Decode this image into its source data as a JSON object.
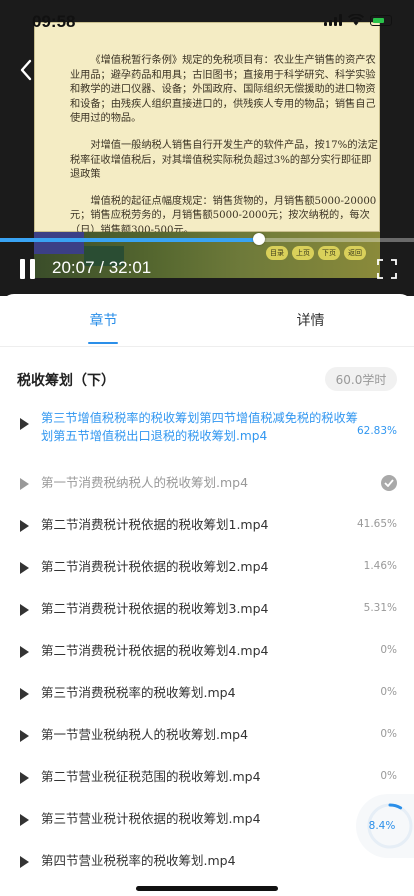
{
  "status_bar": {
    "time": "09:58"
  },
  "player": {
    "slide": {
      "paragraphs": [
        "《增值税暂行条例》规定的免税项目有：农业生产销售的资产农业用品；避孕药品和用具；古旧图书；直接用于科学研究、科学实验和教学的进口仪器、设备；外国政府、国际组织无偿援助的进口物资和设备；由残疾人组织直接进口的，供残疾人专用的物品；销售自己使用过的物品。",
        "对增值一般纳税人销售自行开发生产的软件产品，按17%的法定税率征收增值税后，对其增值税实际税负超过3%的部分实行即征即退政策",
        "增值税的起征点幅度规定：销售货物的，月销售额5000-20000元；销售应税劳务的，月销售额5000-2000元；按次纳税的，每次（日）销售额300-500元。"
      ],
      "tags": [
        "目录",
        "上页",
        "下页",
        "返回"
      ]
    },
    "progress": 0.626,
    "time_readout": "20:07 / 32:01",
    "colors": {
      "accent": "#39a3f3"
    }
  },
  "tabs": [
    {
      "label": "章节",
      "active": true
    },
    {
      "label": "详情",
      "active": false
    }
  ],
  "course": {
    "title": "税收筹划（下）",
    "hours": "60.0学时"
  },
  "lessons": [
    {
      "label": "第三节增值税税率的税收筹划第四节增值税减免税的税收筹划第五节增值税出口退税的税收筹划.mp4",
      "progress": "62.83%",
      "state": "active"
    },
    {
      "label": "第一节消费税纳税人的税收筹划.mp4",
      "progress": "",
      "state": "done"
    },
    {
      "label": "第二节消费税计税依据的税收筹划1.mp4",
      "progress": "41.65%",
      "state": "normal"
    },
    {
      "label": "第二节消费税计税依据的税收筹划2.mp4",
      "progress": "1.46%",
      "state": "normal"
    },
    {
      "label": "第二节消费税计税依据的税收筹划3.mp4",
      "progress": "5.31%",
      "state": "normal"
    },
    {
      "label": "第二节消费税计税依据的税收筹划4.mp4",
      "progress": "0%",
      "state": "normal"
    },
    {
      "label": "第三节消费税税率的税收筹划.mp4",
      "progress": "0%",
      "state": "normal"
    },
    {
      "label": "第一节营业税纳税人的税收筹划.mp4",
      "progress": "0%",
      "state": "normal"
    },
    {
      "label": "第二节营业税征税范围的税收筹划.mp4",
      "progress": "0%",
      "state": "normal"
    },
    {
      "label": "第三节营业税计税依据的税收筹划.mp4",
      "progress": "",
      "state": "normal"
    },
    {
      "label": "第四节营业税税率的税收筹划.mp4",
      "progress": "",
      "state": "normal"
    }
  ],
  "overall_progress": {
    "label": "8.4%",
    "value": 0.084
  }
}
